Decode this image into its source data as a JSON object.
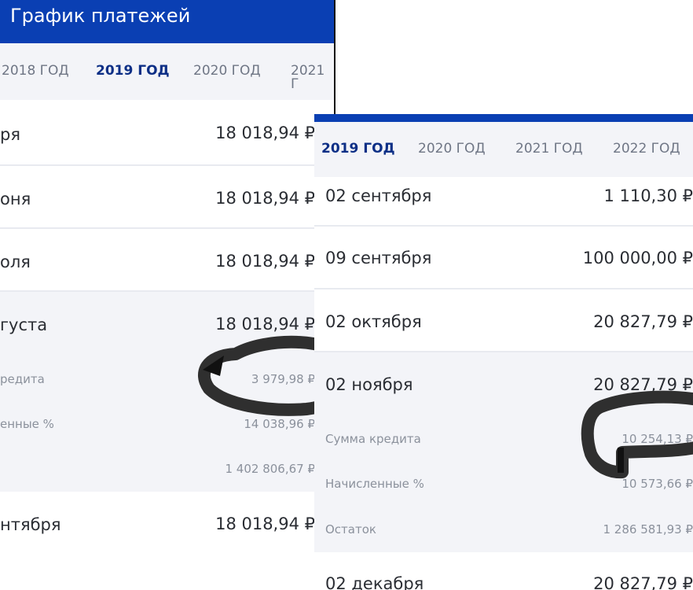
{
  "left": {
    "title": "График платежей",
    "tabs": [
      {
        "label": "2018 ГОД",
        "active": false
      },
      {
        "label": "2019 ГОД",
        "active": true
      },
      {
        "label": "2020 ГОД",
        "active": false
      },
      {
        "label": "2021 Г",
        "active": false
      }
    ],
    "payments": [
      {
        "date": "ря",
        "amount": "18 018,94 ₽"
      },
      {
        "date": "оня",
        "amount": "18 018,94 ₽"
      },
      {
        "date": "оля",
        "amount": "18 018,94 ₽"
      },
      {
        "date": "густа",
        "amount": "18 018,94 ₽"
      }
    ],
    "details": [
      {
        "label": "редита",
        "value": "3 979,98 ₽"
      },
      {
        "label": "енные %",
        "value": "14 038,96 ₽"
      },
      {
        "label": "",
        "value": "1 402 806,67 ₽"
      }
    ],
    "next": {
      "date": "нтября",
      "amount": "18 018,94 ₽"
    }
  },
  "right": {
    "tabs": [
      {
        "label": "2019 ГОД",
        "active": true
      },
      {
        "label": "2020 ГОД",
        "active": false
      },
      {
        "label": "2021 ГОД",
        "active": false
      },
      {
        "label": "2022 ГОД",
        "active": false
      }
    ],
    "payments": [
      {
        "date": "02 сентября",
        "amount": "1 110,30 ₽"
      },
      {
        "date": "09 сентября",
        "amount": "100 000,00 ₽"
      },
      {
        "date": "02 октября",
        "amount": "20 827,79 ₽"
      },
      {
        "date": "02 ноября",
        "amount": "20 827,79 ₽"
      }
    ],
    "details": [
      {
        "label": "Сумма кредита",
        "value": "10 254,13 ₽"
      },
      {
        "label": "Начисленные %",
        "value": "10 573,66 ₽"
      },
      {
        "label": "Остаток",
        "value": "1 286 581,93 ₽"
      }
    ],
    "next": {
      "date": "02 декабря",
      "amount": "20 827,79 ₽"
    }
  },
  "colors": {
    "appbar": "#0a3fb3",
    "active_tab": "#0d2f86",
    "marker": "#2f2f2f"
  }
}
